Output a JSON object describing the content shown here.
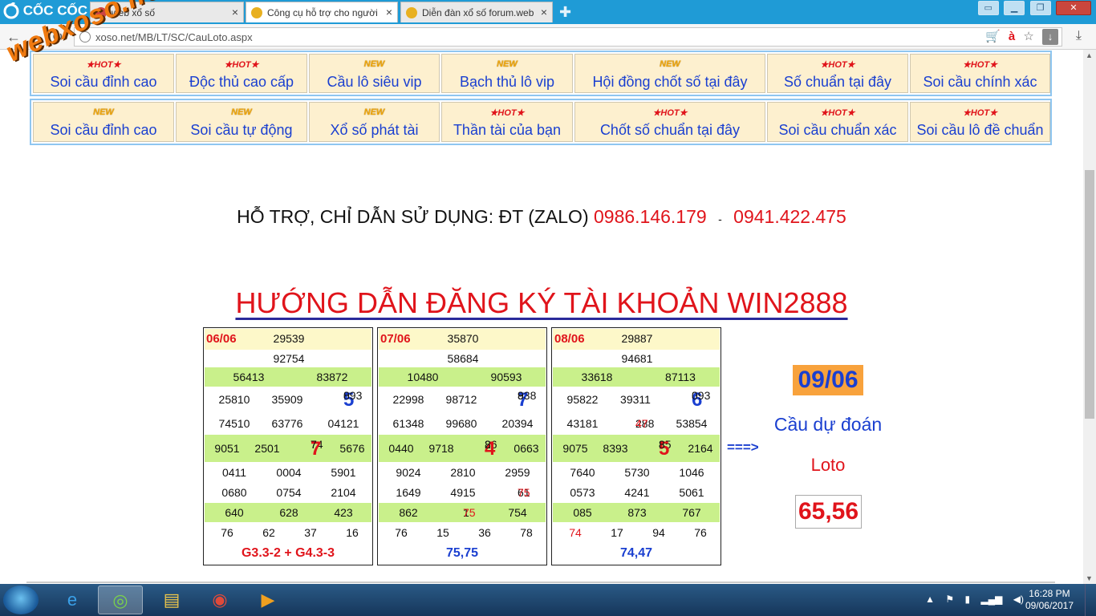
{
  "browser": {
    "brand": "CỐC CỐC",
    "tabs": [
      {
        "label": "web xổ số",
        "active": false
      },
      {
        "label": "Công cụ hỗ trợ cho người",
        "active": true
      },
      {
        "label": "Diễn đàn xổ số forum.web",
        "active": false
      }
    ],
    "url": "xoso.net/MB/LT/SC/CauLoto.aspx",
    "watermark": "webxoso.net"
  },
  "nav_row1": [
    {
      "badge": "HOT",
      "label": "Soi cầu đỉnh cao"
    },
    {
      "badge": "HOT",
      "label": "Độc thủ cao cấp"
    },
    {
      "badge": "NEW",
      "label": "Cầu lô siêu vip"
    },
    {
      "badge": "NEW",
      "label": "Bạch thủ lô vip"
    },
    {
      "badge": "NEW",
      "label": "Hội đồng chốt số tại đây"
    },
    {
      "badge": "HOT",
      "label": "Số chuẩn tại đây"
    },
    {
      "badge": "HOT",
      "label": "Soi cầu chính xác"
    }
  ],
  "nav_row2": [
    {
      "badge": "NEW",
      "label": "Soi cầu đỉnh cao"
    },
    {
      "badge": "NEW",
      "label": "Soi cầu tự động"
    },
    {
      "badge": "NEW",
      "label": "Xổ số phát tài"
    },
    {
      "badge": "HOT",
      "label": "Thần tài của bạn"
    },
    {
      "badge": "HOT",
      "label": "Chốt số chuẩn tại đây"
    },
    {
      "badge": "HOT",
      "label": "Soi cầu chuẩn xác"
    },
    {
      "badge": "HOT",
      "label": "Soi cầu lô đề chuẩn"
    }
  ],
  "support": {
    "text": "HỖ TRỢ, CHỈ DẪN SỬ DỤNG: ĐT (ZALO)",
    "phone1": "0986.146.179",
    "sep": "-",
    "phone2": "0941.422.475"
  },
  "title": "HƯỚNG DẪN ĐĂNG KÝ TÀI KHOẢN WIN2888",
  "results": [
    {
      "date": "06/06",
      "special": "29539",
      "g1": "92754",
      "g2": [
        "56413",
        "83872"
      ],
      "g3a": [
        "25810",
        "35909",
        "0",
        "5",
        "893"
      ],
      "g3b": [
        "74510",
        "63776",
        "04121"
      ],
      "g4": [
        "9051",
        "2501",
        "74",
        "7",
        "7",
        "5676"
      ],
      "g5a": [
        "0411",
        "0004",
        "5901"
      ],
      "g5b": [
        "0680",
        "0754",
        "2104"
      ],
      "g6": [
        "640",
        "628",
        "423"
      ],
      "g7": [
        "76",
        "62",
        "37",
        "16"
      ],
      "foot": "G3.3-2 + G4.3-3"
    },
    {
      "date": "07/06",
      "special": "35870",
      "g1": "58684",
      "g2": [
        "10480",
        "90593"
      ],
      "g3a": [
        "22998",
        "98712",
        "8",
        "7",
        "938"
      ],
      "g3b": [
        "61348",
        "99680",
        "20394"
      ],
      "g4": [
        "0440",
        "9718",
        "26",
        "4",
        "8",
        "0663"
      ],
      "g5a": [
        "9024",
        "2810",
        "2959"
      ],
      "g5b": [
        "1649",
        "4915",
        "61",
        "75"
      ],
      "g6": [
        "862",
        "1",
        "75",
        "754"
      ],
      "g7": [
        "76",
        "15",
        "36",
        "78"
      ],
      "foot": "75,75"
    },
    {
      "date": "08/06",
      "special": "29887",
      "g1": "94681",
      "g2": [
        "33618",
        "87113"
      ],
      "g3a": [
        "95822",
        "39311",
        "3",
        "6",
        "093"
      ],
      "g3b": [
        "43181",
        "288",
        "47",
        "53854"
      ],
      "g4": [
        "9075",
        "8393",
        "85",
        "5",
        "8",
        "2164"
      ],
      "g5a": [
        "7640",
        "5730",
        "1046"
      ],
      "g5b": [
        "0573",
        "4241",
        "5061"
      ],
      "g6": [
        "085",
        "873",
        "767"
      ],
      "g7": [
        "74",
        "17",
        "94",
        "76"
      ],
      "foot": "74,47"
    }
  ],
  "arrow": "===>",
  "prediction": {
    "date": "09/06",
    "label": "Cầu dự đoán",
    "kind": "Loto",
    "value": "65,56"
  },
  "taskbar": {
    "time": "16:28 PM",
    "date": "09/06/2017"
  }
}
